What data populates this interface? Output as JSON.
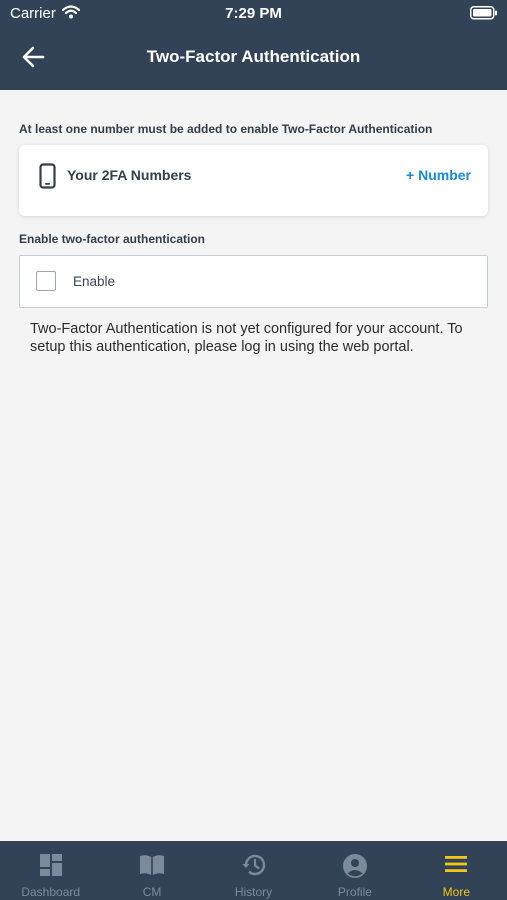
{
  "status_bar": {
    "carrier": "Carrier",
    "time": "7:29 PM"
  },
  "header": {
    "title": "Two-Factor Authentication"
  },
  "numbers_section": {
    "hint": "At least one number must be added to enable Two-Factor Authentication",
    "card_title": "Your 2FA Numbers",
    "add_label": "+ Number"
  },
  "enable_section": {
    "label": "Enable two-factor authentication",
    "checkbox_label": "Enable",
    "checked": false
  },
  "info": "Two-Factor Authentication is not yet configured for your account.  To setup this authentication, please log in using the web portal.",
  "tabs": [
    {
      "label": "Dashboard",
      "icon": "dashboard-icon"
    },
    {
      "label": "CM",
      "icon": "book-icon"
    },
    {
      "label": "History",
      "icon": "history-icon"
    },
    {
      "label": "Profile",
      "icon": "profile-icon"
    },
    {
      "label": "More",
      "icon": "menu-icon",
      "active": true
    }
  ],
  "colors": {
    "header_bg": "#334357",
    "accent": "#1a8ad8",
    "active_tab": "#f2c418",
    "inactive_tab": "#7d8a9b"
  }
}
